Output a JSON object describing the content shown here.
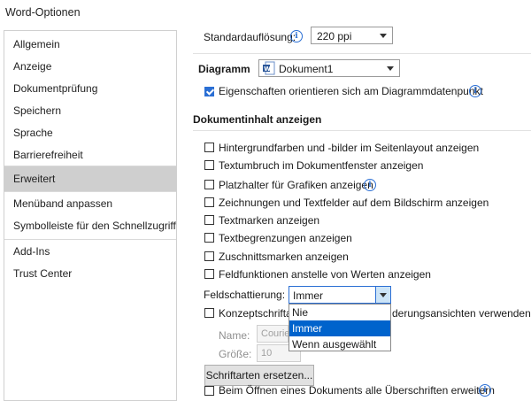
{
  "window": {
    "title": "Word-Optionen"
  },
  "sidebar": {
    "items": [
      {
        "label": "Allgemein"
      },
      {
        "label": "Anzeige"
      },
      {
        "label": "Dokumentprüfung"
      },
      {
        "label": "Speichern"
      },
      {
        "label": "Sprache"
      },
      {
        "label": "Barrierefreiheit"
      },
      {
        "label": "Erweitert",
        "selected": true
      },
      {
        "label": "Menüband anpassen"
      },
      {
        "label": "Symbolleiste für den Schnellzugriff"
      },
      {
        "label": "Add-Ins"
      },
      {
        "label": "Trust Center"
      }
    ]
  },
  "main": {
    "resolution": {
      "label": "Standardauflösung:",
      "value": "220 ppi"
    },
    "diagram": {
      "label": "Diagramm",
      "value": "Dokument1"
    },
    "chart_option": {
      "label": "Eigenschaften orientieren sich am Diagrammdatenpunkt",
      "checked": true
    },
    "section_title": "Dokumentinhalt anzeigen",
    "options": [
      {
        "label": "Hintergrundfarben und -bilder im Seitenlayout anzeigen",
        "checked": false
      },
      {
        "label": "Textumbruch im Dokumentfenster anzeigen",
        "checked": false
      },
      {
        "label": "Platzhalter für Grafiken anzeigen",
        "checked": false,
        "info": true
      },
      {
        "label": "Zeichnungen und Textfelder auf dem Bildschirm anzeigen",
        "checked": false
      },
      {
        "label": "Textmarken anzeigen",
        "checked": false
      },
      {
        "label": "Textbegrenzungen anzeigen",
        "checked": false
      },
      {
        "label": "Zuschnittsmarken anzeigen",
        "checked": false
      },
      {
        "label": "Feldfunktionen anstelle von Werten anzeigen",
        "checked": false
      }
    ],
    "field_shading": {
      "label": "Feldschattierung:",
      "value": "Immer",
      "options": [
        "Nie",
        "Immer",
        "Wenn ausgewählt"
      ],
      "highlighted": "Immer"
    },
    "draft_font": {
      "label_start": "Konzeptschriftar",
      "label_end": "derungsansichten verwenden",
      "checked": false,
      "name_label": "Name:",
      "name_value": "Courie",
      "size_label": "Größe:",
      "size_value": "10"
    },
    "replace_fonts_button": "Schriftarten ersetzen...",
    "expand_headings": {
      "label": "Beim Öffnen eines Dokuments alle Überschriften erweitern",
      "checked": false
    },
    "info_glyph": "i"
  }
}
